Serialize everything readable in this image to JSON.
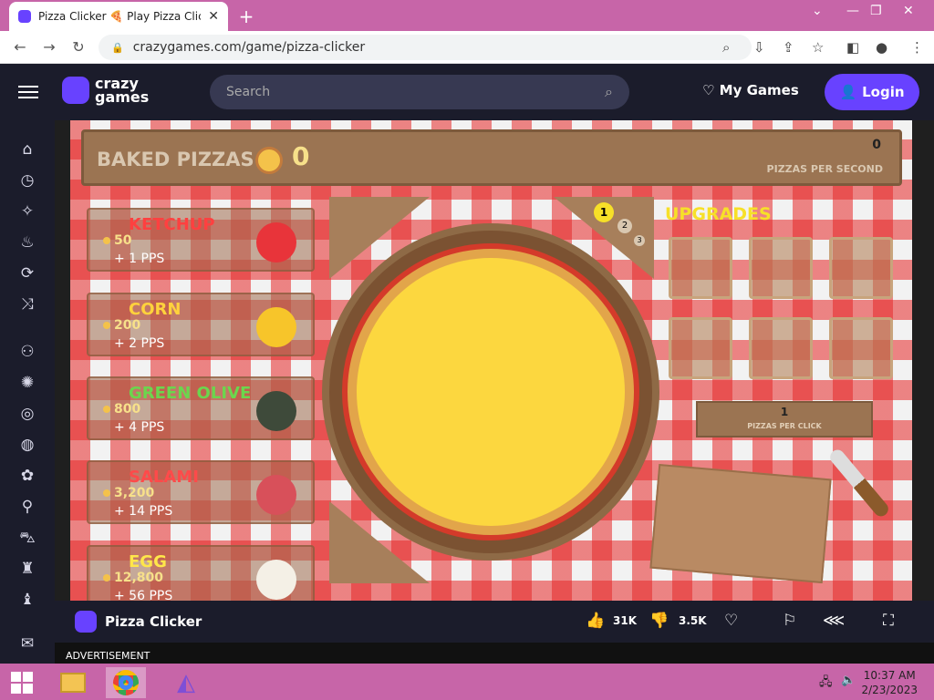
{
  "browser": {
    "tab_title": "Pizza Clicker 🍕 Play Pizza Clicker",
    "url": "crazygames.com/game/pizza-clicker"
  },
  "site": {
    "logo_line1": "crazy",
    "logo_line2": "games",
    "search_placeholder": "Search",
    "my_games": "My Games",
    "login": "Login"
  },
  "game": {
    "baked_label": "BAKED PIZZAS",
    "baked_count": "0",
    "pps_value": "0",
    "pps_label": "PIZZAS PER SECOND",
    "ingredients": [
      {
        "name": "KETCHUP",
        "price": "50",
        "pps": "+ 1 PPS",
        "color": "#ff3b3b"
      },
      {
        "name": "CORN",
        "price": "200",
        "pps": "+ 2 PPS",
        "color": "#ffd23c"
      },
      {
        "name": "GREEN OLIVE",
        "price": "800",
        "pps": "+ 4 PPS",
        "color": "#6bd64d"
      },
      {
        "name": "SALAMI",
        "price": "3,200",
        "pps": "+ 14 PPS",
        "color": "#ff4a4a"
      },
      {
        "name": "EGG",
        "price": "12,800",
        "pps": "+ 56 PPS",
        "color": "#ffe64a"
      }
    ],
    "upgrades_label": "UPGRADES",
    "page_one": "1",
    "page_two": "2",
    "page_three": "3",
    "per_click_value": "1",
    "per_click_label": "PIZZAS PER CLICK"
  },
  "gamebar": {
    "title": "Pizza Clicker",
    "likes": "31K",
    "dislikes": "3.5K"
  },
  "advertisement": "ADVERTISEMENT",
  "taskbar": {
    "time": "10:37 AM",
    "date": "2/23/2023"
  },
  "colors": {
    "accent": "#6842ff",
    "taskbar": "#c765a8",
    "header": "#1b1c2b"
  }
}
